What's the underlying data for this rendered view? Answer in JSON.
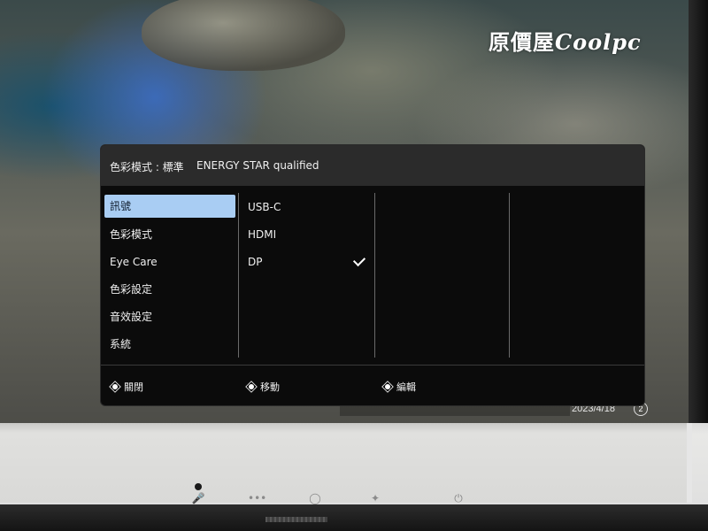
{
  "watermark": {
    "text": "原價屋",
    "brand": "Coolpc"
  },
  "osd": {
    "header": {
      "color_mode": "色彩模式 : 標準",
      "badge": "ENERGY STAR qualified"
    },
    "menu": [
      {
        "label": "訊號",
        "selected": true
      },
      {
        "label": "色彩模式",
        "selected": false
      },
      {
        "label": "Eye Care",
        "selected": false
      },
      {
        "label": "色彩設定",
        "selected": false
      },
      {
        "label": "音效設定",
        "selected": false
      },
      {
        "label": "系統",
        "selected": false
      }
    ],
    "submenu": [
      {
        "label": "USB-C",
        "checked": false
      },
      {
        "label": "HDMI",
        "checked": false
      },
      {
        "label": "DP",
        "checked": true
      }
    ],
    "footer": {
      "close": "關閉",
      "move": "移動",
      "edit": "編輯"
    }
  },
  "taskbar": {
    "date": "2023/4/18",
    "notification_count": "2"
  },
  "bezel_buttons": {
    "mic": "mic-icon",
    "audio": "audio-wave-icon",
    "eye_care": "bulb-icon",
    "menu": "joystick-icon",
    "power": "power-icon"
  },
  "colors": {
    "selected_item_bg": "#a9cdf3",
    "osd_bg": "#0b0b0b",
    "osd_header_bg": "#2b2b2b"
  }
}
